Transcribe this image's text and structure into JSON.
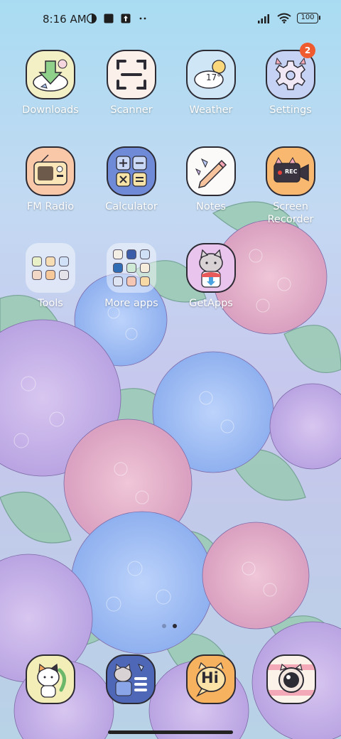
{
  "status_bar": {
    "time": "8:16 AM",
    "battery": "100"
  },
  "apps": [
    {
      "label": "Downloads"
    },
    {
      "label": "Scanner"
    },
    {
      "label": "Weather",
      "temperature": "17°"
    },
    {
      "label": "Settings",
      "badge": "2"
    },
    {
      "label": "FM Radio"
    },
    {
      "label": "Calculator"
    },
    {
      "label": "Notes"
    },
    {
      "label": "Screen Recorder",
      "rec_text": "REC"
    },
    {
      "label": "Tools"
    },
    {
      "label": "More apps"
    },
    {
      "label": "GetApps"
    }
  ],
  "dock": {
    "chat_text": "Hi"
  },
  "pager": {
    "current_page": 2,
    "total_pages": 2
  },
  "colors": {
    "label_text": "#ffffff",
    "badge": "#ef5b2f",
    "icon_outline": "#2c2a33"
  }
}
